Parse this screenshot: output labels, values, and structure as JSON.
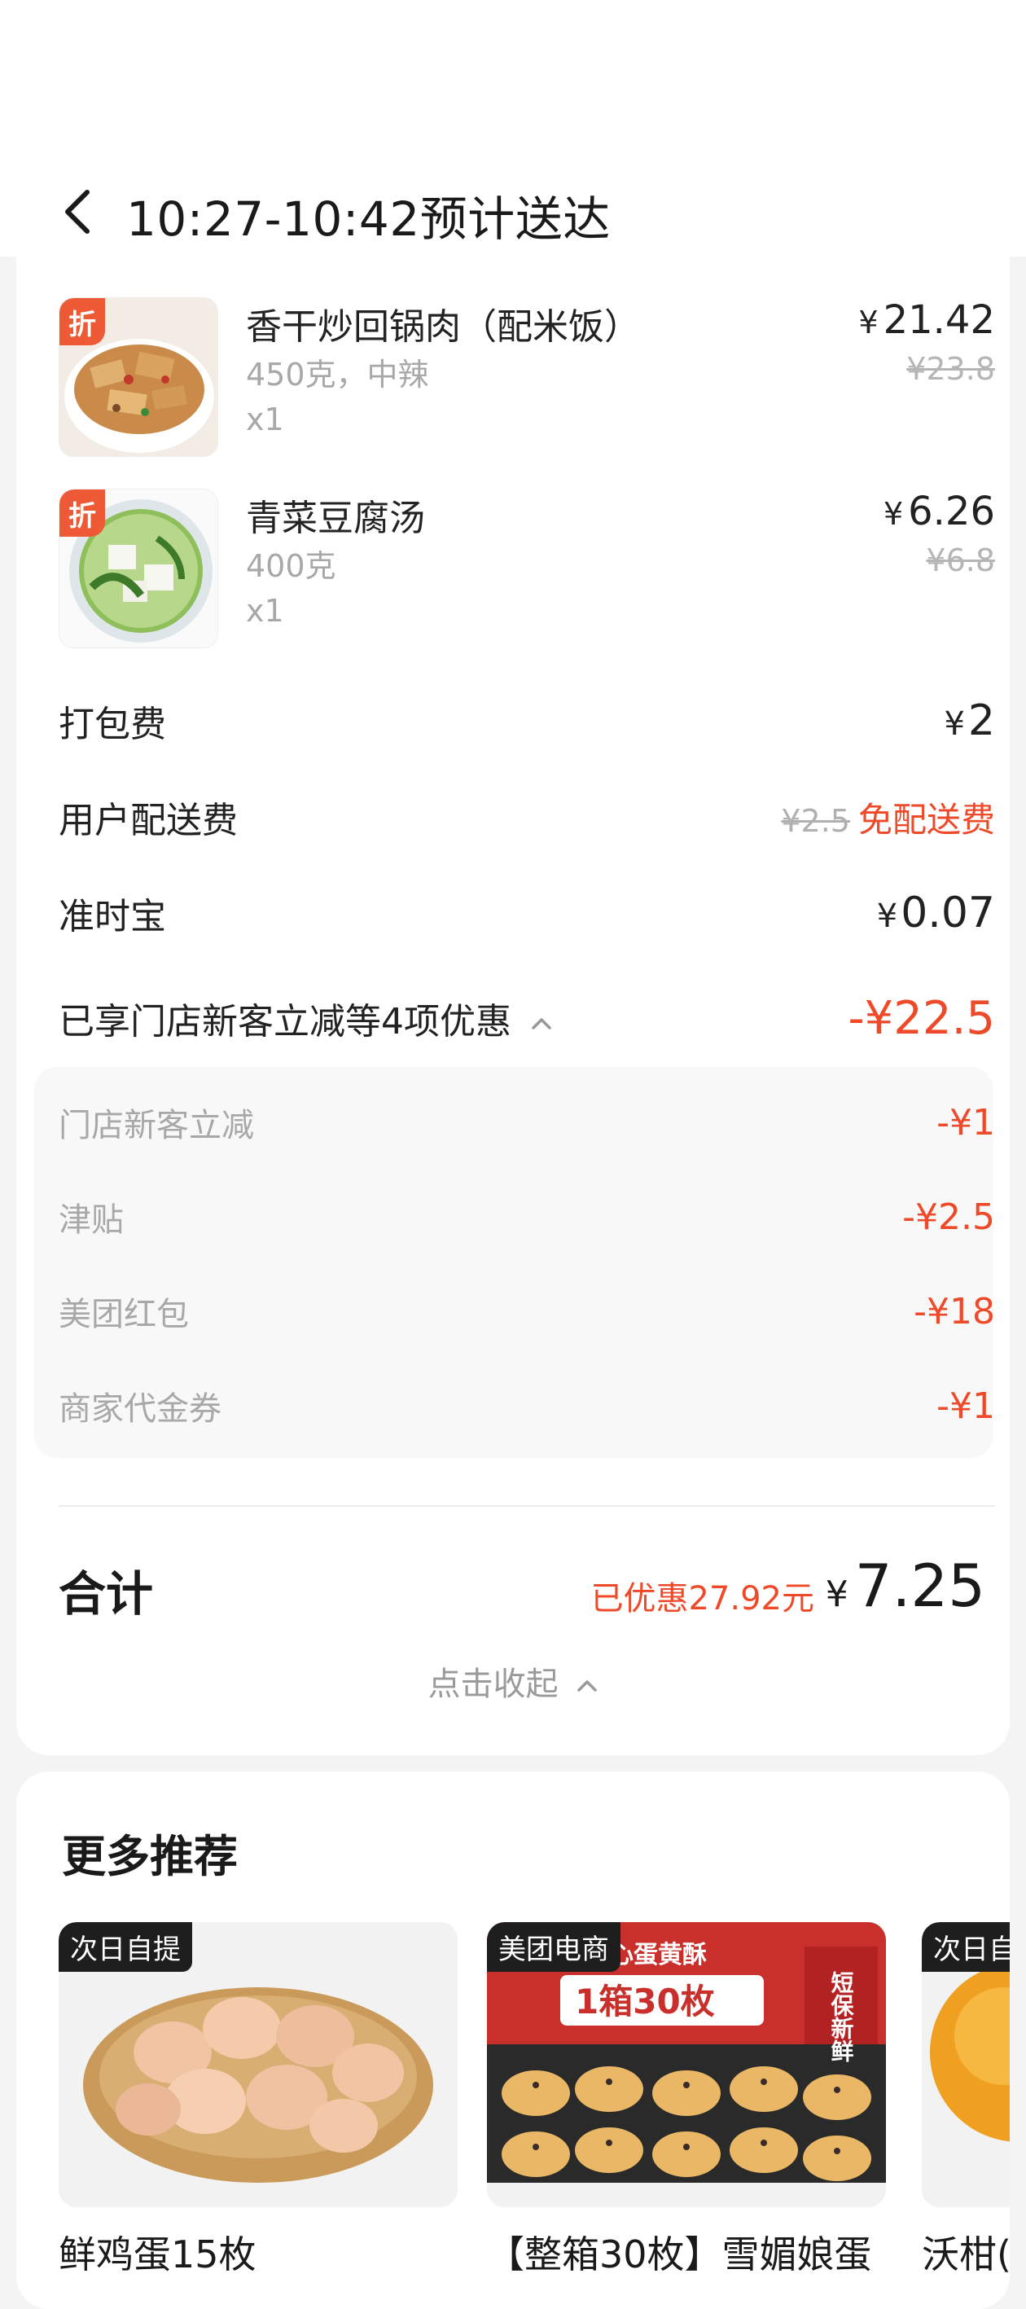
{
  "header": {
    "title": "10:27-10:42预计送达"
  },
  "items": [
    {
      "badge": "折",
      "name": "香干炒回锅肉（配米饭）",
      "spec": "450克，中辣",
      "qty": "x1",
      "price_symbol": "¥",
      "price": "21.42",
      "original_price": "¥23.8"
    },
    {
      "badge": "折",
      "name": "青菜豆腐汤",
      "spec": "400克",
      "qty": "x1",
      "price_symbol": "¥",
      "price": "6.26",
      "original_price": "¥6.8"
    }
  ],
  "fees": {
    "packing_label": "打包费",
    "packing_symbol": "¥",
    "packing_value": "2",
    "delivery_label": "用户配送费",
    "delivery_original": "¥2.5",
    "delivery_free": "免配送费",
    "ontime_label": "准时宝",
    "ontime_symbol": "¥",
    "ontime_value": "0.07"
  },
  "discounts": {
    "summary_label": "已享门店新客立减等4项优惠",
    "summary_value": "-¥22.5",
    "list": [
      {
        "label": "门店新客立减",
        "value": "-¥1"
      },
      {
        "label": "津贴",
        "value": "-¥2.5"
      },
      {
        "label": "美团红包",
        "value": "-¥18"
      },
      {
        "label": "商家代金券",
        "value": "-¥1"
      }
    ]
  },
  "total": {
    "label": "合计",
    "saved": "已优惠27.92元",
    "symbol": "¥",
    "amount": "7.25",
    "collapse_label": "点击收起"
  },
  "recommend": {
    "title": "更多推荐",
    "items": [
      {
        "tag": "次日自提",
        "name": "鲜鸡蛋15枚"
      },
      {
        "tag": "美团电商",
        "name": "【整箱30枚】雪媚娘蛋",
        "box_text_1": "雪媚娘夹心蛋黄酥",
        "box_text_2": "1箱30枚",
        "box_text_3": "短保新鲜"
      },
      {
        "tag": "次日自提",
        "name": "沃柑("
      }
    ]
  },
  "colors": {
    "accent": "#ee4a2a",
    "badge": "#ee5a36"
  },
  "icons": {
    "back": "back-arrow-icon",
    "collapse": "chevron-up-icon"
  }
}
